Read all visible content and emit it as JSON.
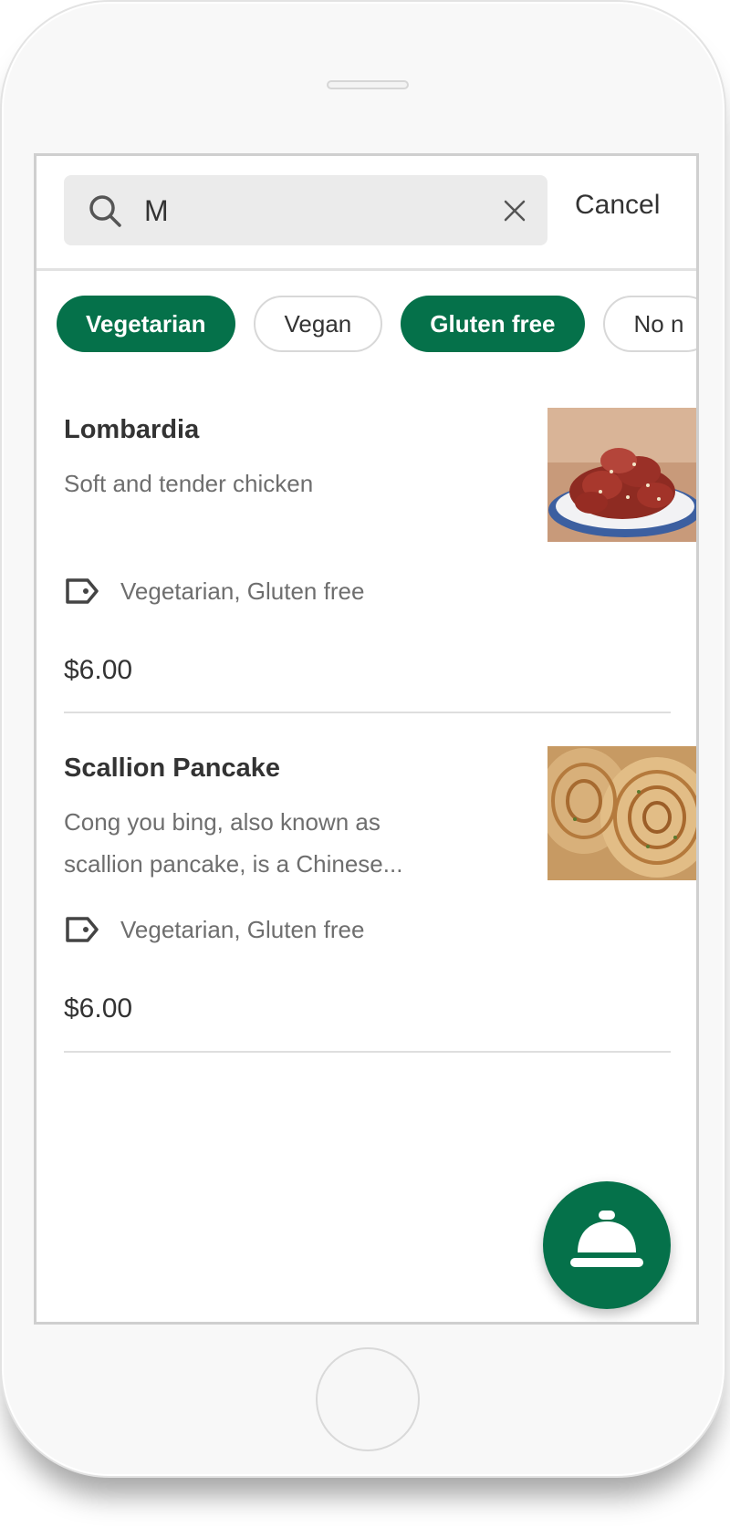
{
  "search": {
    "query": "M",
    "cancel_label": "Cancel"
  },
  "filters": [
    {
      "label": "Vegetarian",
      "active": true
    },
    {
      "label": "Vegan",
      "active": false
    },
    {
      "label": "Gluten free",
      "active": true
    },
    {
      "label": "No n",
      "active": false
    }
  ],
  "items": [
    {
      "name": "Lombardia",
      "description": "Soft and tender chicken",
      "tags": "Vegetarian, Gluten free",
      "price": "$6.00",
      "photo_icon": "fried-chicken-photo"
    },
    {
      "name": "Scallion Pancake",
      "description": "Cong you bing, also known as scallion pancake, is a Chinese...",
      "tags": "Vegetarian, Gluten free",
      "price": "$6.00",
      "photo_icon": "scallion-pancake-photo"
    }
  ],
  "fab": {
    "icon": "service-bell-icon"
  },
  "colors": {
    "brand_green": "#05714a",
    "text_primary": "#333333",
    "text_secondary": "#6e6e6e"
  }
}
